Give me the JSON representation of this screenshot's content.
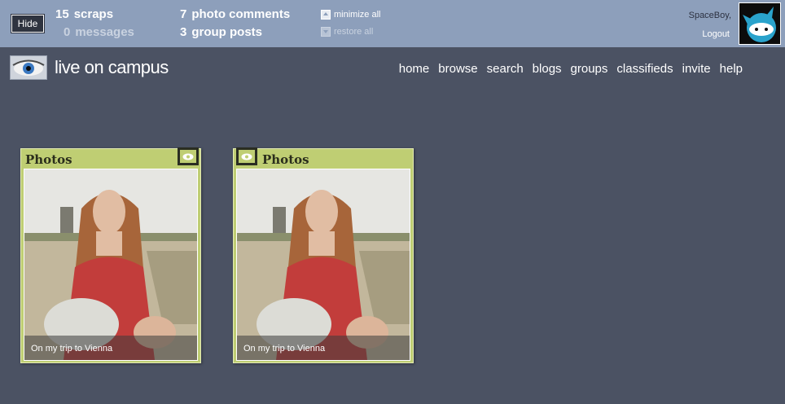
{
  "topbar": {
    "hide_label": "Hide",
    "stats": {
      "scraps": {
        "count": "15",
        "label": "scraps"
      },
      "messages": {
        "count": "0",
        "label": "messages"
      },
      "photo_comments": {
        "count": "7",
        "label": "photo comments"
      },
      "group_posts": {
        "count": "3",
        "label": "group posts"
      }
    },
    "minimize_label": "minimize all",
    "restore_label": "restore all",
    "username": "SpaceBoy,",
    "logout_label": "Logout"
  },
  "header": {
    "brand": "live on campus",
    "nav": [
      "home",
      "browse",
      "search",
      "blogs",
      "groups",
      "classifieds",
      "invite",
      "help"
    ]
  },
  "widgets": [
    {
      "title": "Photos",
      "caption": "On my trip to Vienna"
    },
    {
      "title": "Photos",
      "caption": "On my trip to Vienna"
    }
  ],
  "colors": {
    "topbar": "#8d9fbb",
    "background": "#4b5263",
    "widget": "#bfce73"
  }
}
